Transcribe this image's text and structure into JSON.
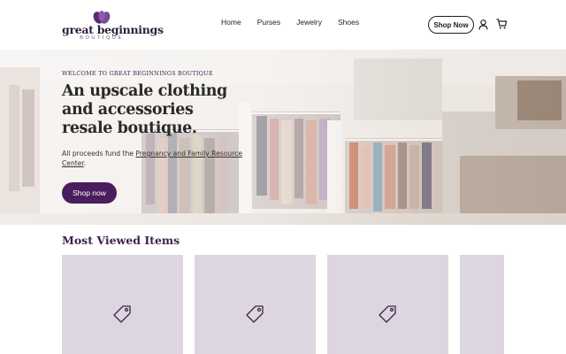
{
  "brand": {
    "name": "great beginnings",
    "sub": "BOUTIQUE",
    "accent": "#4a1d5e"
  },
  "nav": {
    "items": [
      {
        "label": "Home"
      },
      {
        "label": "Purses"
      },
      {
        "label": "Jewelry"
      },
      {
        "label": "Shoes"
      }
    ],
    "shop_now_label": "Shop Now",
    "account_icon": "user-icon",
    "cart_icon": "cart-icon"
  },
  "hero": {
    "eyebrow": "WELCOME TO GREAT BEGINNINGS BOUTIQUE",
    "title": "An upscale clothing and accessories resale boutique.",
    "desc_prefix": "All proceeds fund the ",
    "desc_link": "Pregnancy and Family Resource Center",
    "desc_suffix": ".",
    "button_label": "Shop now"
  },
  "most_viewed": {
    "title": "Most Viewed Items",
    "cards": [
      {
        "icon": "tag-icon"
      },
      {
        "icon": "tag-icon"
      },
      {
        "icon": "tag-icon"
      },
      {
        "icon": "tag-icon"
      }
    ]
  }
}
